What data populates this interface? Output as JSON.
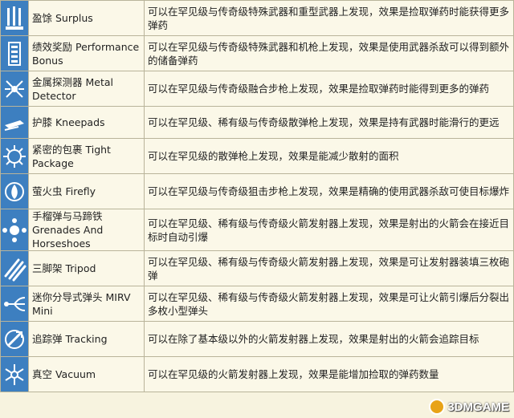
{
  "rows": [
    {
      "icon": "surplus-icon",
      "name": "盈馀 Surplus",
      "desc": "可以在罕见级与传奇级特殊武器和重型武器上发现，效果是捡取弹药时能获得更多弹药"
    },
    {
      "icon": "performance-bonus-icon",
      "name": "绩效奖励 Performance Bonus",
      "desc": "可以在罕见级与传奇级特殊武器和机枪上发现，效果是使用武器杀敌可以得到额外的储备弹药"
    },
    {
      "icon": "metal-detector-icon",
      "name": "金属探测器 Metal Detector",
      "desc": "可以在罕见级与传奇级融合步枪上发现，效果是捡取弹药时能得到更多的弹药"
    },
    {
      "icon": "kneepads-icon",
      "name": "护膝 Kneepads",
      "desc": "可以在罕见级、稀有级与传奇级散弹枪上发现，效果是持有武器时能滑行的更远"
    },
    {
      "icon": "tight-package-icon",
      "name": "紧密的包裹 Tight Package",
      "desc": "可以在罕见级的散弹枪上发现，效果是能减少散射的面积"
    },
    {
      "icon": "firefly-icon",
      "name": "萤火虫 Firefly",
      "desc": "可以在罕见级与传奇级狙击步枪上发现，效果是精确的使用武器杀敌可使目标爆炸"
    },
    {
      "icon": "grenades-horseshoes-icon",
      "name": "手榴弹与马蹄铁 Grenades And Horseshoes",
      "desc": "可以在罕见级、稀有级与传奇级火箭发射器上发现，效果是射出的火箭会在接近目标时自动引爆"
    },
    {
      "icon": "tripod-icon",
      "name": "三脚架 Tripod",
      "desc": "可以在罕见级、稀有级与传奇级火箭发射器上发现，效果是可让发射器装填三枚砲弹"
    },
    {
      "icon": "mirv-mini-icon",
      "name": "迷你分导式弹头 MIRV Mini",
      "desc": "可以在罕见级、稀有级与传奇级火箭发射器上发现，效果是可让火箭引爆后分裂出多枚小型弹头"
    },
    {
      "icon": "tracking-icon",
      "name": "追踪弹 Tracking",
      "desc": "可以在除了基本级以外的火箭发射器上发现，效果是射出的火箭会追踪目标"
    },
    {
      "icon": "vacuum-icon",
      "name": "真空 Vacuum",
      "desc": "可以在罕见级的火箭发射器上发现，效果是能增加捡取的弹药数量"
    }
  ],
  "watermark": {
    "text": "3DMGAME",
    "logo_icon": "3dm-logo-icon"
  }
}
